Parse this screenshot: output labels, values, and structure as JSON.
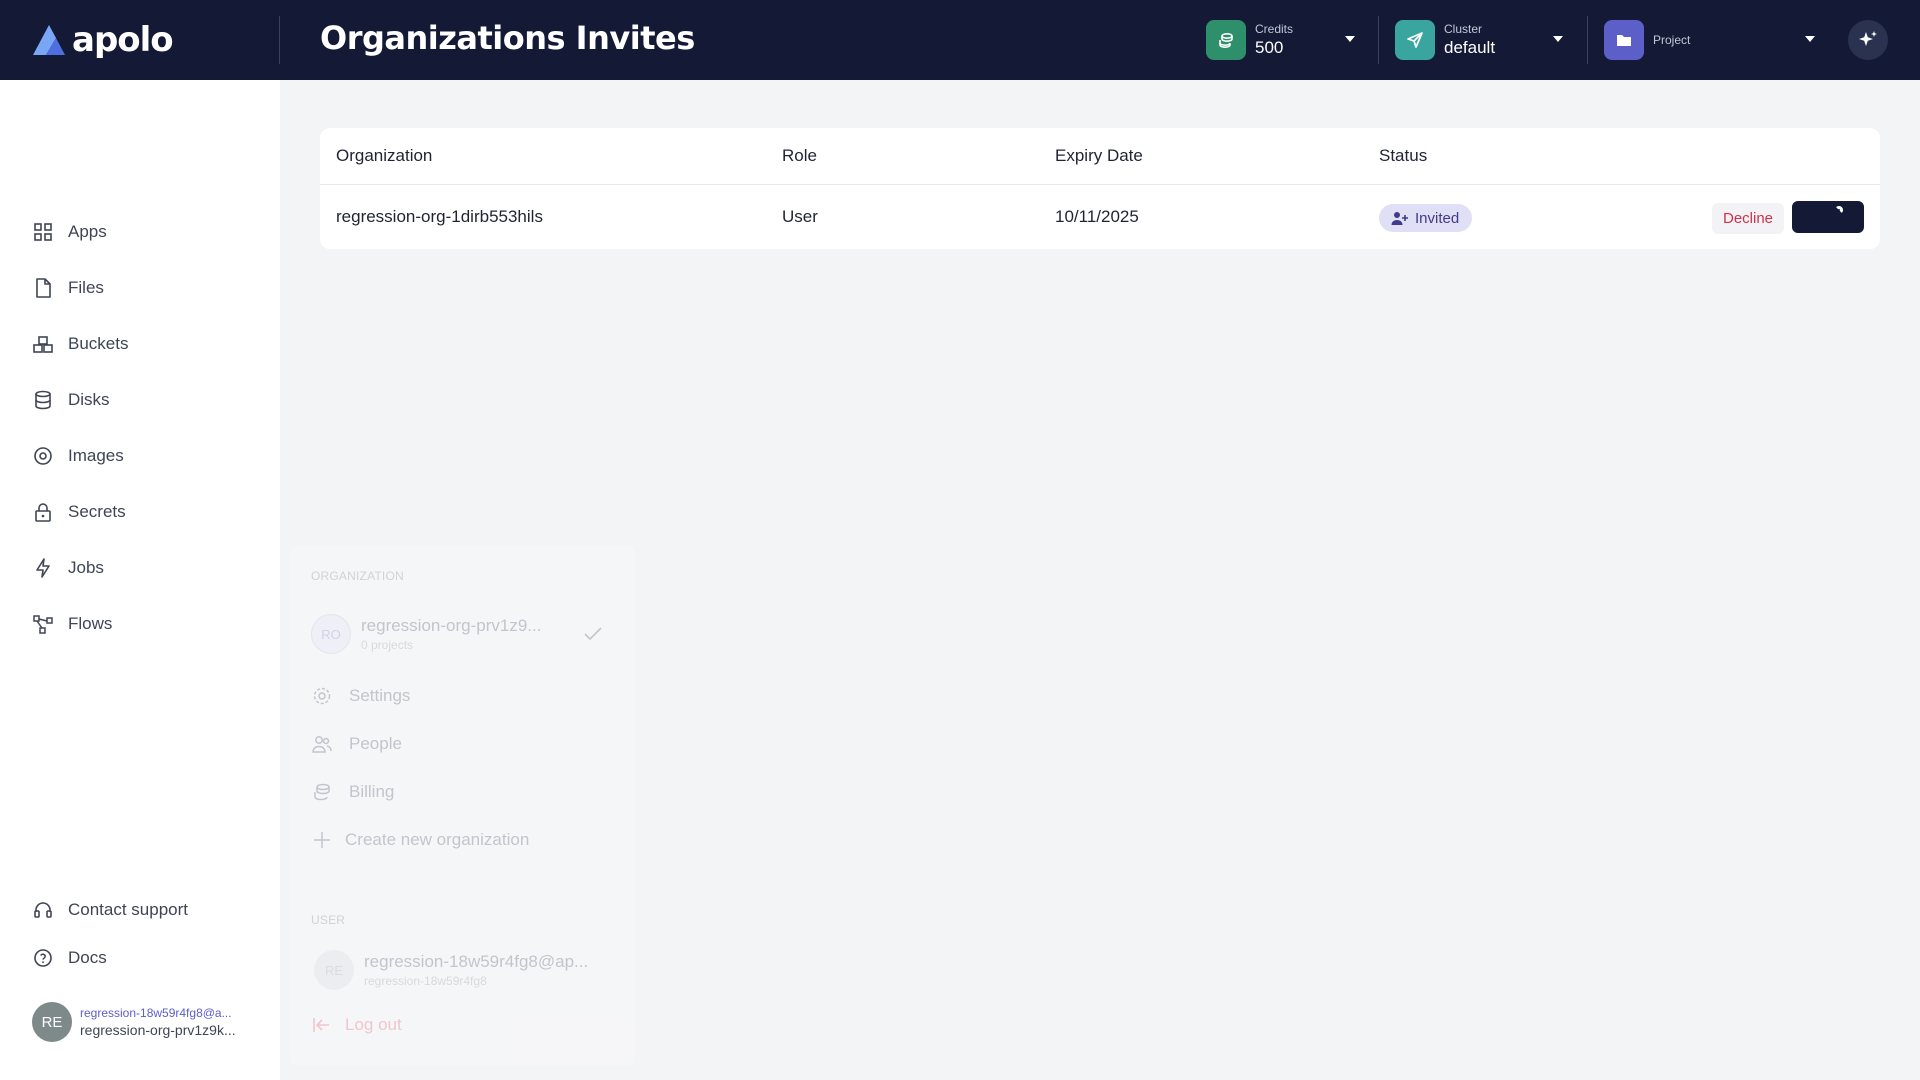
{
  "header": {
    "logo_text": "apolo",
    "page_title": "Organizations Invites",
    "credits": {
      "label": "Credits",
      "value": "500",
      "color": "#2e8f6b"
    },
    "cluster": {
      "label": "Cluster",
      "value": "default",
      "color": "#3aa59f"
    },
    "project": {
      "label": "Project",
      "value": "",
      "color": "#5b5fc7"
    },
    "ai_icon": "sparkles-icon"
  },
  "sidebar": {
    "items": [
      {
        "label": "Apps",
        "icon": "apps-grid-icon"
      },
      {
        "label": "Files",
        "icon": "file-icon"
      },
      {
        "label": "Buckets",
        "icon": "bucket-icon"
      },
      {
        "label": "Disks",
        "icon": "database-icon"
      },
      {
        "label": "Images",
        "icon": "image-disc-icon"
      },
      {
        "label": "Secrets",
        "icon": "lock-icon"
      },
      {
        "label": "Jobs",
        "icon": "lightning-icon"
      },
      {
        "label": "Flows",
        "icon": "flows-icon"
      }
    ],
    "bottom": [
      {
        "label": "Contact support",
        "icon": "headset-icon"
      },
      {
        "label": "Docs",
        "icon": "help-circle-icon"
      }
    ],
    "user": {
      "initials": "RE",
      "email": "regression-18w59r4fg8@a...",
      "org": "regression-org-prv1z9k..."
    }
  },
  "table": {
    "headers": [
      "Organization",
      "Role",
      "Expiry Date",
      "Status"
    ],
    "rows": [
      {
        "organization": "regression-org-1dirb553hils",
        "role": "User",
        "expiry": "10/11/2025",
        "status": "Invited",
        "decline_label": "Decline"
      }
    ]
  },
  "popover": {
    "org_section": "ORGANIZATION",
    "org_initials": "RO",
    "org_name": "regression-org-prv1z9...",
    "org_projects": "0 projects",
    "items": [
      "Settings",
      "People",
      "Billing",
      "Create new organization"
    ],
    "user_section": "USER",
    "user_initials": "RE",
    "user_email": "regression-18w59r4fg8@ap...",
    "user_name": "regression-18w59r4fg8",
    "logout": "Log out"
  }
}
